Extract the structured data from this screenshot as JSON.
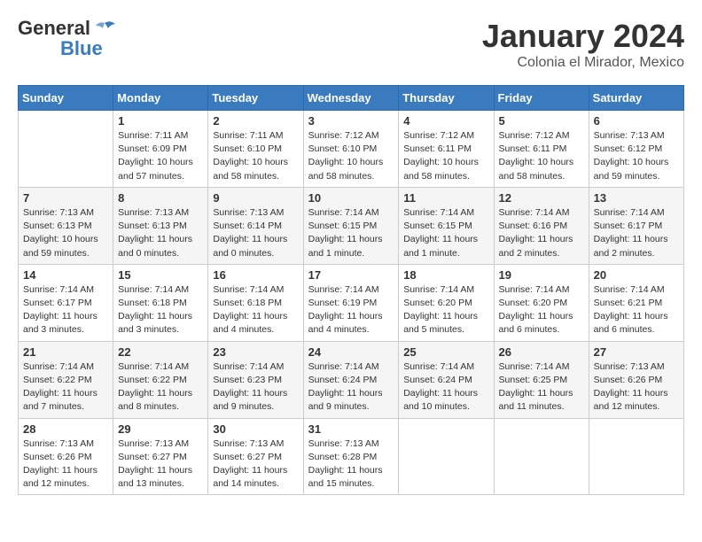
{
  "header": {
    "logo_line1": "General",
    "logo_line2": "Blue",
    "month_title": "January 2024",
    "subtitle": "Colonia el Mirador, Mexico"
  },
  "weekdays": [
    "Sunday",
    "Monday",
    "Tuesday",
    "Wednesday",
    "Thursday",
    "Friday",
    "Saturday"
  ],
  "weeks": [
    [
      {
        "day": "",
        "info": ""
      },
      {
        "day": "1",
        "info": "Sunrise: 7:11 AM\nSunset: 6:09 PM\nDaylight: 10 hours\nand 57 minutes."
      },
      {
        "day": "2",
        "info": "Sunrise: 7:11 AM\nSunset: 6:10 PM\nDaylight: 10 hours\nand 58 minutes."
      },
      {
        "day": "3",
        "info": "Sunrise: 7:12 AM\nSunset: 6:10 PM\nDaylight: 10 hours\nand 58 minutes."
      },
      {
        "day": "4",
        "info": "Sunrise: 7:12 AM\nSunset: 6:11 PM\nDaylight: 10 hours\nand 58 minutes."
      },
      {
        "day": "5",
        "info": "Sunrise: 7:12 AM\nSunset: 6:11 PM\nDaylight: 10 hours\nand 58 minutes."
      },
      {
        "day": "6",
        "info": "Sunrise: 7:13 AM\nSunset: 6:12 PM\nDaylight: 10 hours\nand 59 minutes."
      }
    ],
    [
      {
        "day": "7",
        "info": "Sunrise: 7:13 AM\nSunset: 6:13 PM\nDaylight: 10 hours\nand 59 minutes."
      },
      {
        "day": "8",
        "info": "Sunrise: 7:13 AM\nSunset: 6:13 PM\nDaylight: 11 hours\nand 0 minutes."
      },
      {
        "day": "9",
        "info": "Sunrise: 7:13 AM\nSunset: 6:14 PM\nDaylight: 11 hours\nand 0 minutes."
      },
      {
        "day": "10",
        "info": "Sunrise: 7:14 AM\nSunset: 6:15 PM\nDaylight: 11 hours\nand 1 minute."
      },
      {
        "day": "11",
        "info": "Sunrise: 7:14 AM\nSunset: 6:15 PM\nDaylight: 11 hours\nand 1 minute."
      },
      {
        "day": "12",
        "info": "Sunrise: 7:14 AM\nSunset: 6:16 PM\nDaylight: 11 hours\nand 2 minutes."
      },
      {
        "day": "13",
        "info": "Sunrise: 7:14 AM\nSunset: 6:17 PM\nDaylight: 11 hours\nand 2 minutes."
      }
    ],
    [
      {
        "day": "14",
        "info": "Sunrise: 7:14 AM\nSunset: 6:17 PM\nDaylight: 11 hours\nand 3 minutes."
      },
      {
        "day": "15",
        "info": "Sunrise: 7:14 AM\nSunset: 6:18 PM\nDaylight: 11 hours\nand 3 minutes."
      },
      {
        "day": "16",
        "info": "Sunrise: 7:14 AM\nSunset: 6:18 PM\nDaylight: 11 hours\nand 4 minutes."
      },
      {
        "day": "17",
        "info": "Sunrise: 7:14 AM\nSunset: 6:19 PM\nDaylight: 11 hours\nand 4 minutes."
      },
      {
        "day": "18",
        "info": "Sunrise: 7:14 AM\nSunset: 6:20 PM\nDaylight: 11 hours\nand 5 minutes."
      },
      {
        "day": "19",
        "info": "Sunrise: 7:14 AM\nSunset: 6:20 PM\nDaylight: 11 hours\nand 6 minutes."
      },
      {
        "day": "20",
        "info": "Sunrise: 7:14 AM\nSunset: 6:21 PM\nDaylight: 11 hours\nand 6 minutes."
      }
    ],
    [
      {
        "day": "21",
        "info": "Sunrise: 7:14 AM\nSunset: 6:22 PM\nDaylight: 11 hours\nand 7 minutes."
      },
      {
        "day": "22",
        "info": "Sunrise: 7:14 AM\nSunset: 6:22 PM\nDaylight: 11 hours\nand 8 minutes."
      },
      {
        "day": "23",
        "info": "Sunrise: 7:14 AM\nSunset: 6:23 PM\nDaylight: 11 hours\nand 9 minutes."
      },
      {
        "day": "24",
        "info": "Sunrise: 7:14 AM\nSunset: 6:24 PM\nDaylight: 11 hours\nand 9 minutes."
      },
      {
        "day": "25",
        "info": "Sunrise: 7:14 AM\nSunset: 6:24 PM\nDaylight: 11 hours\nand 10 minutes."
      },
      {
        "day": "26",
        "info": "Sunrise: 7:14 AM\nSunset: 6:25 PM\nDaylight: 11 hours\nand 11 minutes."
      },
      {
        "day": "27",
        "info": "Sunrise: 7:13 AM\nSunset: 6:26 PM\nDaylight: 11 hours\nand 12 minutes."
      }
    ],
    [
      {
        "day": "28",
        "info": "Sunrise: 7:13 AM\nSunset: 6:26 PM\nDaylight: 11 hours\nand 12 minutes."
      },
      {
        "day": "29",
        "info": "Sunrise: 7:13 AM\nSunset: 6:27 PM\nDaylight: 11 hours\nand 13 minutes."
      },
      {
        "day": "30",
        "info": "Sunrise: 7:13 AM\nSunset: 6:27 PM\nDaylight: 11 hours\nand 14 minutes."
      },
      {
        "day": "31",
        "info": "Sunrise: 7:13 AM\nSunset: 6:28 PM\nDaylight: 11 hours\nand 15 minutes."
      },
      {
        "day": "",
        "info": ""
      },
      {
        "day": "",
        "info": ""
      },
      {
        "day": "",
        "info": ""
      }
    ]
  ]
}
